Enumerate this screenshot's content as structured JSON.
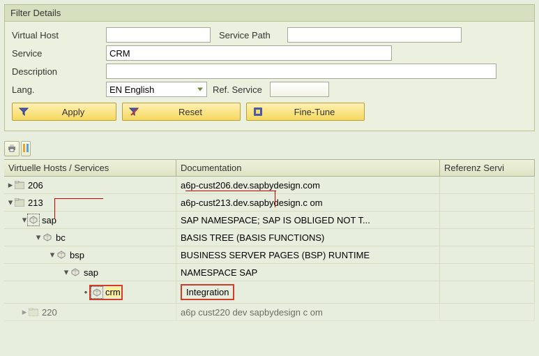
{
  "panel": {
    "title": "Filter Details"
  },
  "form": {
    "virtual_host_label": "Virtual Host",
    "virtual_host_value": "",
    "service_path_label": "Service Path",
    "service_path_value": "",
    "service_label": "Service",
    "service_value": "CRM",
    "description_label": "Description",
    "description_value": "",
    "lang_label": "Lang.",
    "lang_value": "EN English",
    "ref_service_label": "Ref. Service",
    "ref_service_value": ""
  },
  "buttons": {
    "apply": "Apply",
    "reset": "Reset",
    "fine_tune": "Fine-Tune"
  },
  "grid": {
    "headers": {
      "col1": "Virtuelle Hosts / Services",
      "col2": "Documentation",
      "col3": "Referenz Servi"
    },
    "rows": [
      {
        "level": 0,
        "expander": "▸",
        "icon": "folder",
        "label": "206",
        "doc": "a6p-cust206.dev.sapbydesign.com",
        "ref": ""
      },
      {
        "level": 0,
        "expander": "▾",
        "icon": "folder",
        "label": "213",
        "doc": "a6p-cust213.dev.sapbydesign.c om",
        "ref": ""
      },
      {
        "level": 1,
        "expander": "▾",
        "icon": "node",
        "dotted": true,
        "label": "sap",
        "doc": "SAP NAMESPACE; SAP IS OBLIGED NOT T...",
        "ref": ""
      },
      {
        "level": 2,
        "expander": "▾",
        "icon": "node",
        "label": "bc",
        "doc": "BASIS TREE (BASIS FUNCTIONS)",
        "ref": ""
      },
      {
        "level": 3,
        "expander": "▾",
        "icon": "node",
        "label": "bsp",
        "doc": "BUSINESS SERVER PAGES (BSP) RUNTIME",
        "ref": ""
      },
      {
        "level": 4,
        "expander": "▾",
        "icon": "node",
        "label": "sap",
        "doc": "NAMESPACE SAP",
        "ref": ""
      },
      {
        "level": 5,
        "expander": "•",
        "icon": "node",
        "dotted": true,
        "selected": true,
        "highlight": true,
        "label": "crm",
        "doc": "Integration",
        "ref": ""
      },
      {
        "level": 6,
        "expander": "▸",
        "icon": "folder",
        "label": "220",
        "doc": "a6p cust220 dev sapbydesign c om",
        "ref": "",
        "faded": true
      }
    ]
  }
}
